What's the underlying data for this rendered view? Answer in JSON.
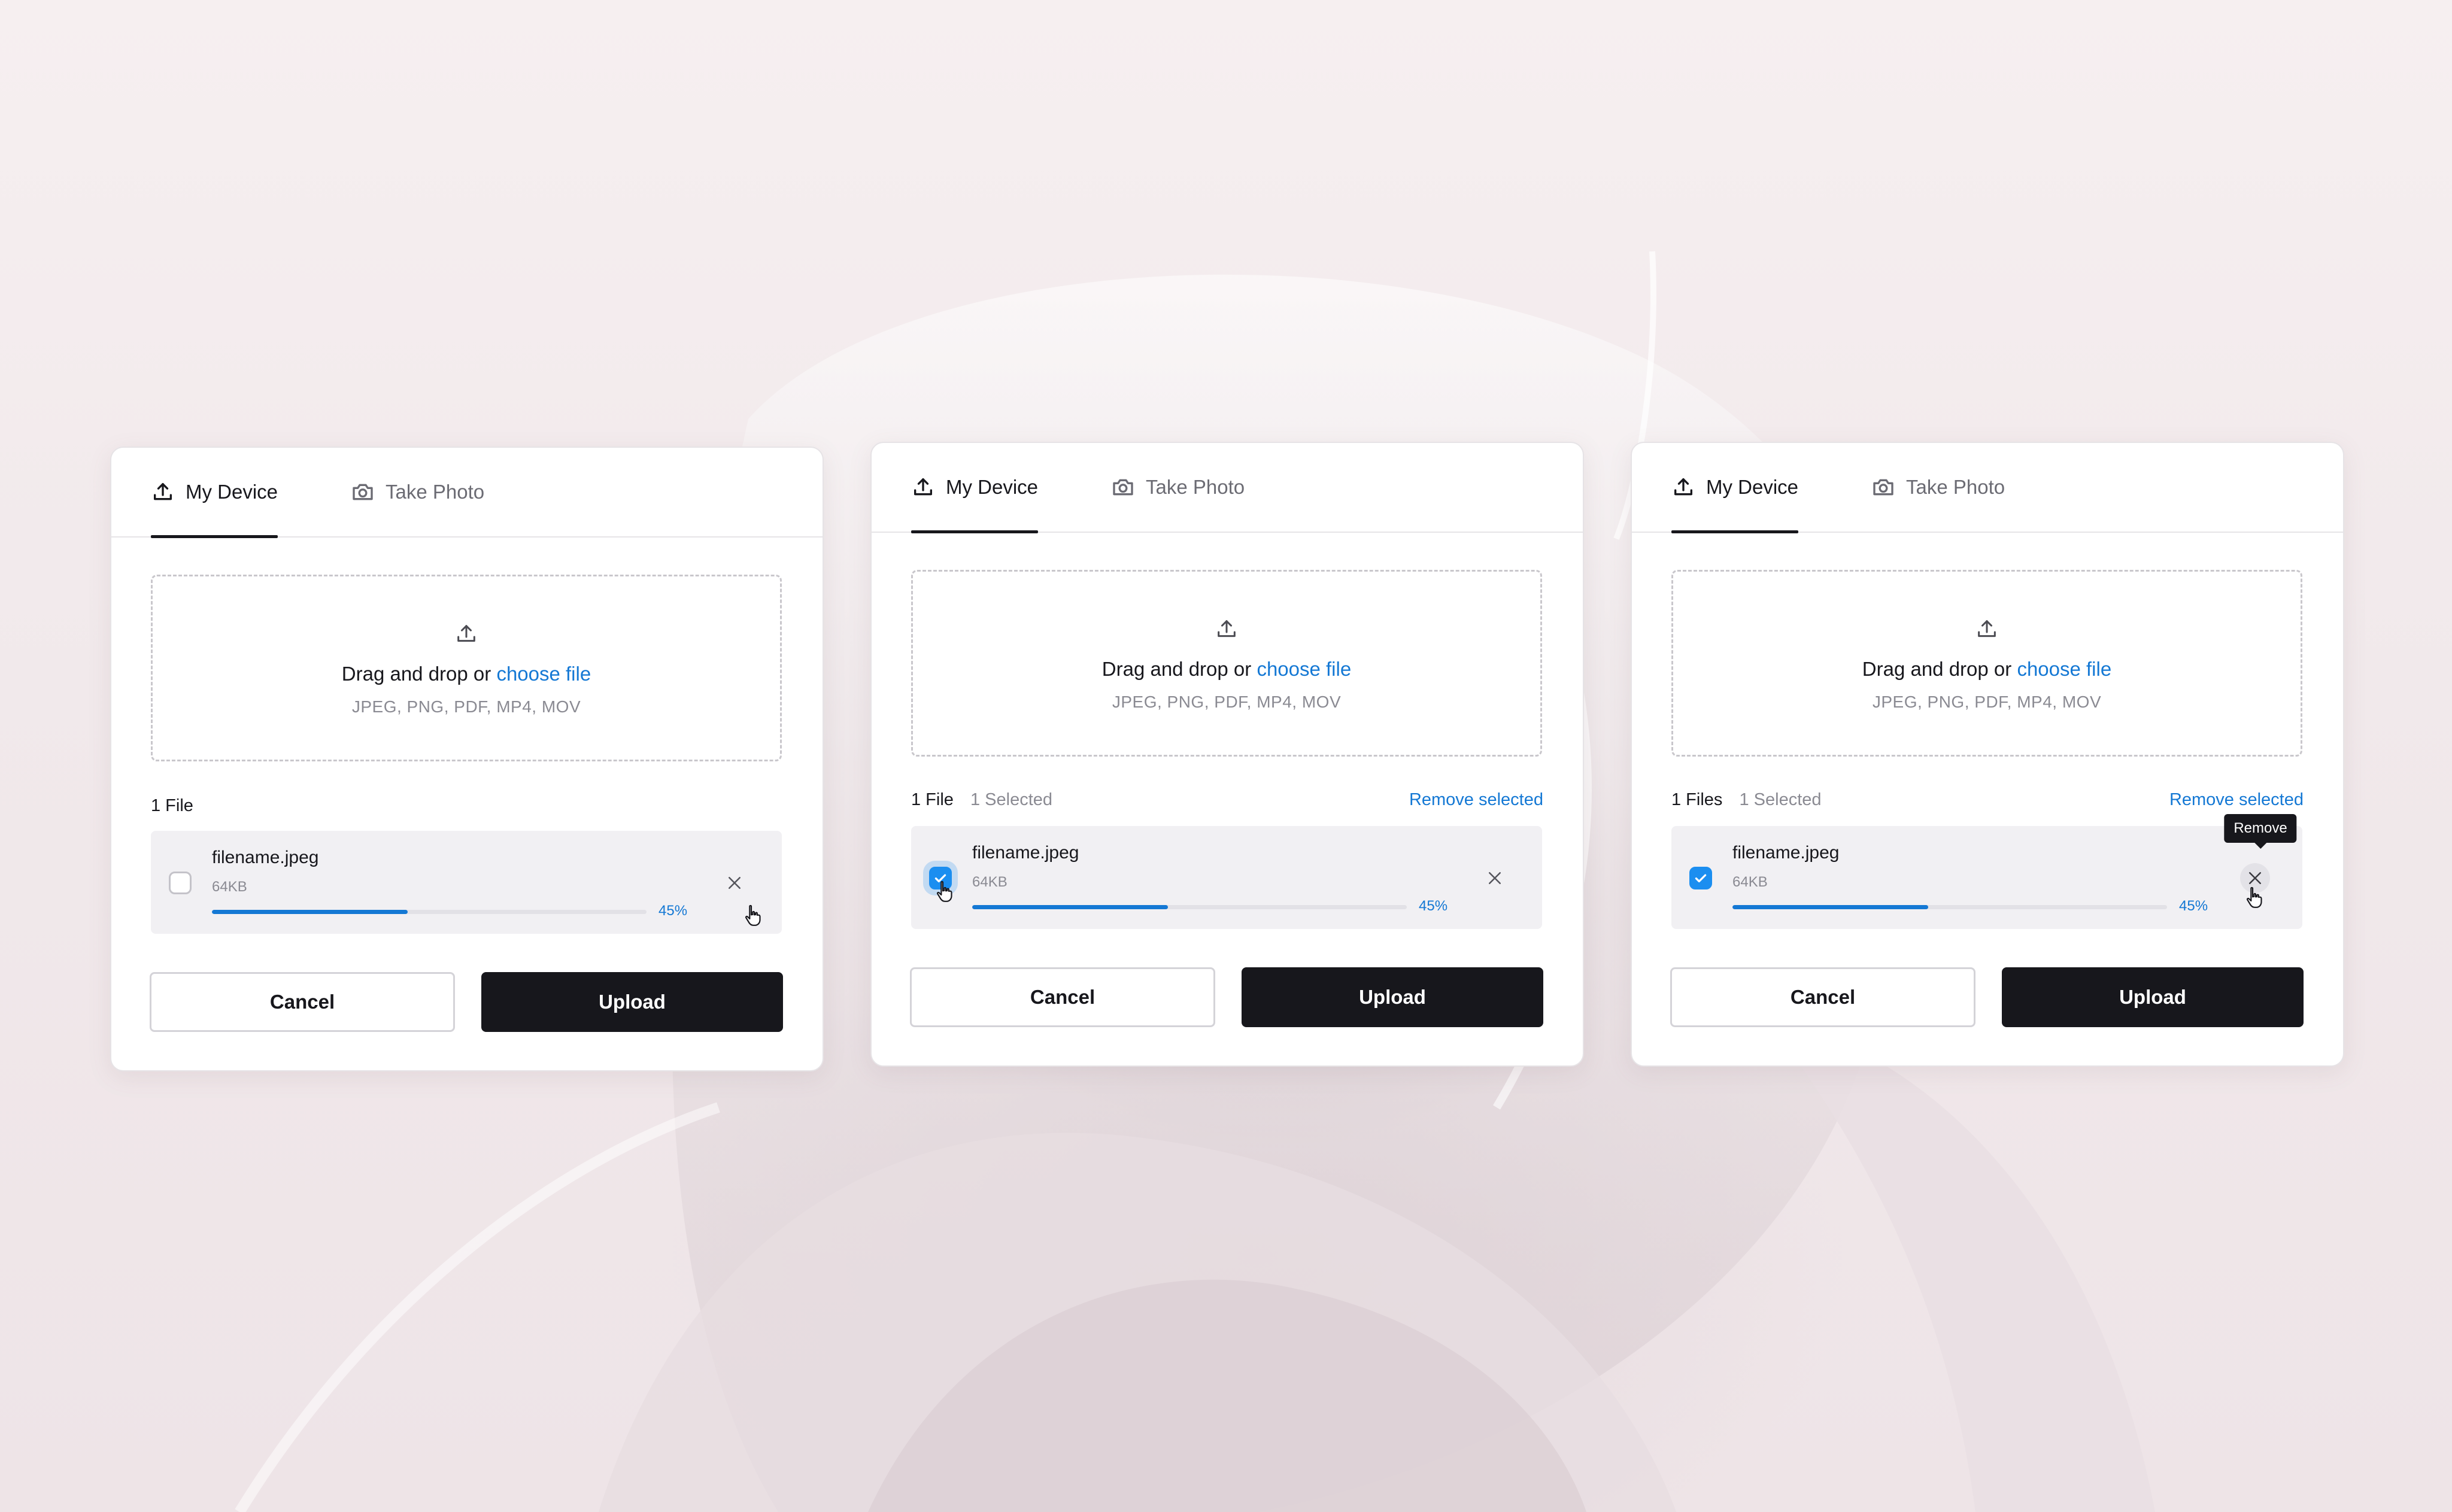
{
  "colors": {
    "accent": "#1478d4",
    "checkbox_checked": "#1b8ef0",
    "primary_button": "#17171c",
    "background": "#f3ecee"
  },
  "panels": [
    {
      "tabs": [
        {
          "label": "My Device",
          "icon": "upload-icon",
          "active": true
        },
        {
          "label": "Take Photo",
          "icon": "camera-icon",
          "active": false
        }
      ],
      "dropzone": {
        "text": "Drag and drop or",
        "link": "choose file",
        "types": "JPEG, PNG, PDF, MP4, MOV"
      },
      "files_header": {
        "count": "1 File",
        "selected": "",
        "remove_label": ""
      },
      "file": {
        "name": "filename.jpeg",
        "size": "64KB",
        "progress_percent": 45,
        "progress_label": "45%",
        "checked": false
      },
      "actions": {
        "cancel": "Cancel",
        "upload": "Upload"
      }
    },
    {
      "tabs": [
        {
          "label": "My Device",
          "icon": "upload-icon",
          "active": true
        },
        {
          "label": "Take Photo",
          "icon": "camera-icon",
          "active": false
        }
      ],
      "dropzone": {
        "text": "Drag and drop or",
        "link": "choose file",
        "types": "JPEG, PNG, PDF, MP4, MOV"
      },
      "files_header": {
        "count": "1 File",
        "selected": "1 Selected",
        "remove_label": "Remove selected"
      },
      "file": {
        "name": "filename.jpeg",
        "size": "64KB",
        "progress_percent": 45,
        "progress_label": "45%",
        "checked": true
      },
      "actions": {
        "cancel": "Cancel",
        "upload": "Upload"
      }
    },
    {
      "tabs": [
        {
          "label": "My Device",
          "icon": "upload-icon",
          "active": true
        },
        {
          "label": "Take Photo",
          "icon": "camera-icon",
          "active": false
        }
      ],
      "dropzone": {
        "text": "Drag and drop or",
        "link": "choose file",
        "types": "JPEG, PNG, PDF, MP4, MOV"
      },
      "files_header": {
        "count": "1 Files",
        "selected": "1 Selected",
        "remove_label": "Remove selected"
      },
      "file": {
        "name": "filename.jpeg",
        "size": "64KB",
        "progress_percent": 45,
        "progress_label": "45%",
        "checked": true
      },
      "tooltip": "Remove",
      "actions": {
        "cancel": "Cancel",
        "upload": "Upload"
      }
    }
  ]
}
